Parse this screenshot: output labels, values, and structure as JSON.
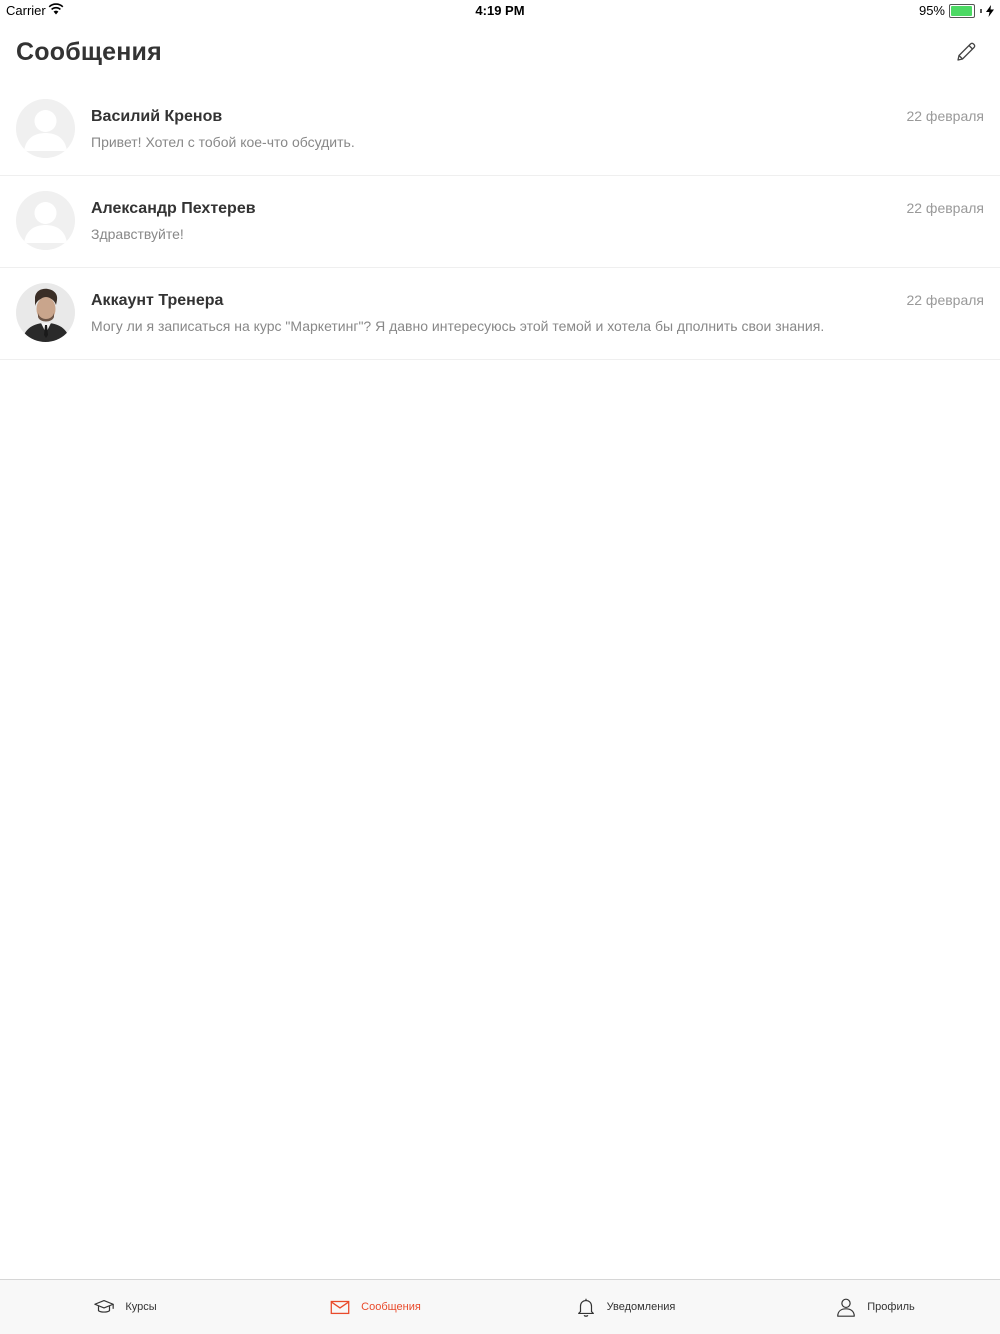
{
  "status_bar": {
    "carrier": "Carrier",
    "time": "4:19 PM",
    "battery": "95%",
    "battery_level": 0.95,
    "battery_color": "#4cd964"
  },
  "header": {
    "title": "Сообщения",
    "compose_icon": "pencil-icon"
  },
  "conversations": [
    {
      "name": "Василий Кренов",
      "preview": "Привет! Хотел с тобой кое-что обсудить.",
      "date": "22 февраля",
      "avatar": "default-avatar"
    },
    {
      "name": "Александр Пехтерев",
      "preview": "Здравствуйте!",
      "date": "22 февраля",
      "avatar": "default-avatar"
    },
    {
      "name": "Аккаунт Тренера",
      "preview": "Могу ли я записаться на курс \"Маркетинг\"? Я давно интересуюсь этой темой и хотела бы дполнить свои знания.",
      "date": "22 февраля",
      "avatar": "photo-avatar"
    }
  ],
  "tab_bar": {
    "accent_color": "#e94b2c",
    "tabs": [
      {
        "label": "Курсы",
        "icon": "graduation-cap-icon",
        "active": false
      },
      {
        "label": "Сообщения",
        "icon": "envelope-icon",
        "active": true
      },
      {
        "label": "Уведомления",
        "icon": "bell-icon",
        "active": false
      },
      {
        "label": "Профиль",
        "icon": "user-icon",
        "active": false
      }
    ]
  }
}
